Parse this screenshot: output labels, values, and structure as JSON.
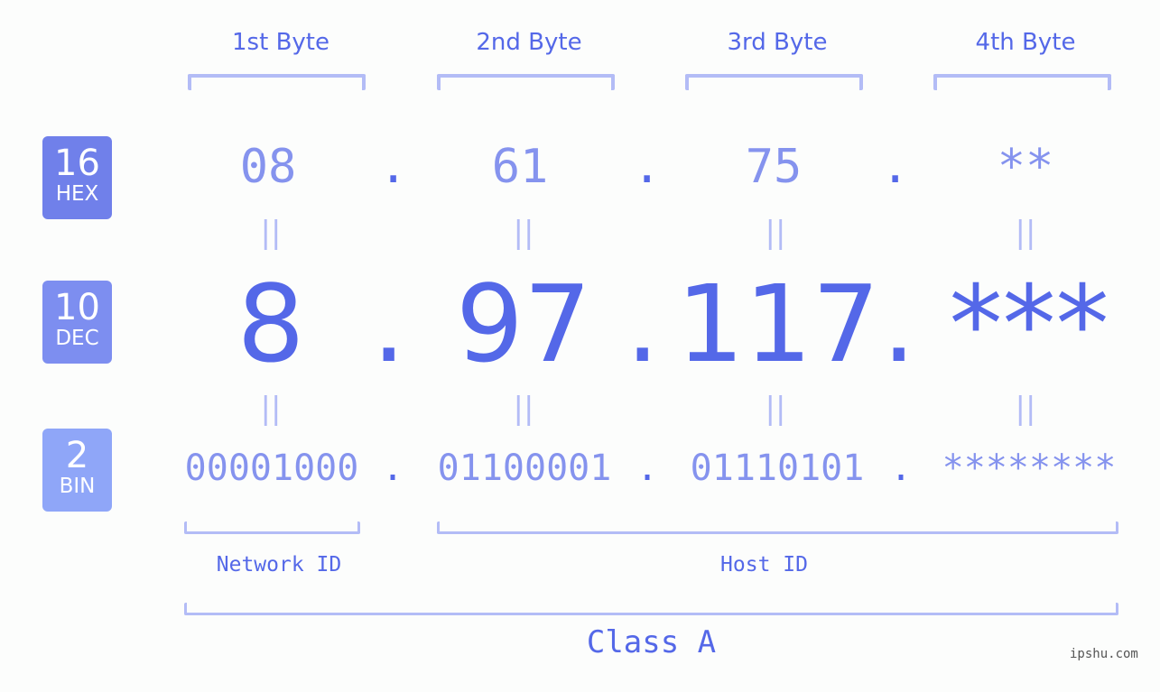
{
  "bytes": {
    "headers": [
      "1st Byte",
      "2nd Byte",
      "3rd Byte",
      "4th Byte"
    ]
  },
  "badges": {
    "hex": {
      "number": "16",
      "label": "HEX",
      "color": "#7080ea"
    },
    "dec": {
      "number": "10",
      "label": "DEC",
      "color": "#7d8ef0"
    },
    "bin": {
      "number": "2",
      "label": "BIN",
      "color": "#8fa6f8"
    }
  },
  "hex": {
    "values": [
      "08",
      "61",
      "75",
      "**"
    ],
    "separator": "."
  },
  "dec": {
    "values": [
      "8",
      "97",
      "117",
      "***"
    ],
    "separator": "."
  },
  "bin": {
    "values": [
      "00001000",
      "01100001",
      "01110101",
      "********"
    ],
    "separator": "."
  },
  "equals_symbol": "||",
  "network_id_label": "Network ID",
  "host_id_label": "Host ID",
  "class_label": "Class A",
  "watermark": "ipshu.com",
  "colors": {
    "accent": "#5468e8",
    "light_accent": "#8593ee",
    "bracket": "#b3bcf6",
    "background": "#fcfdfc"
  }
}
